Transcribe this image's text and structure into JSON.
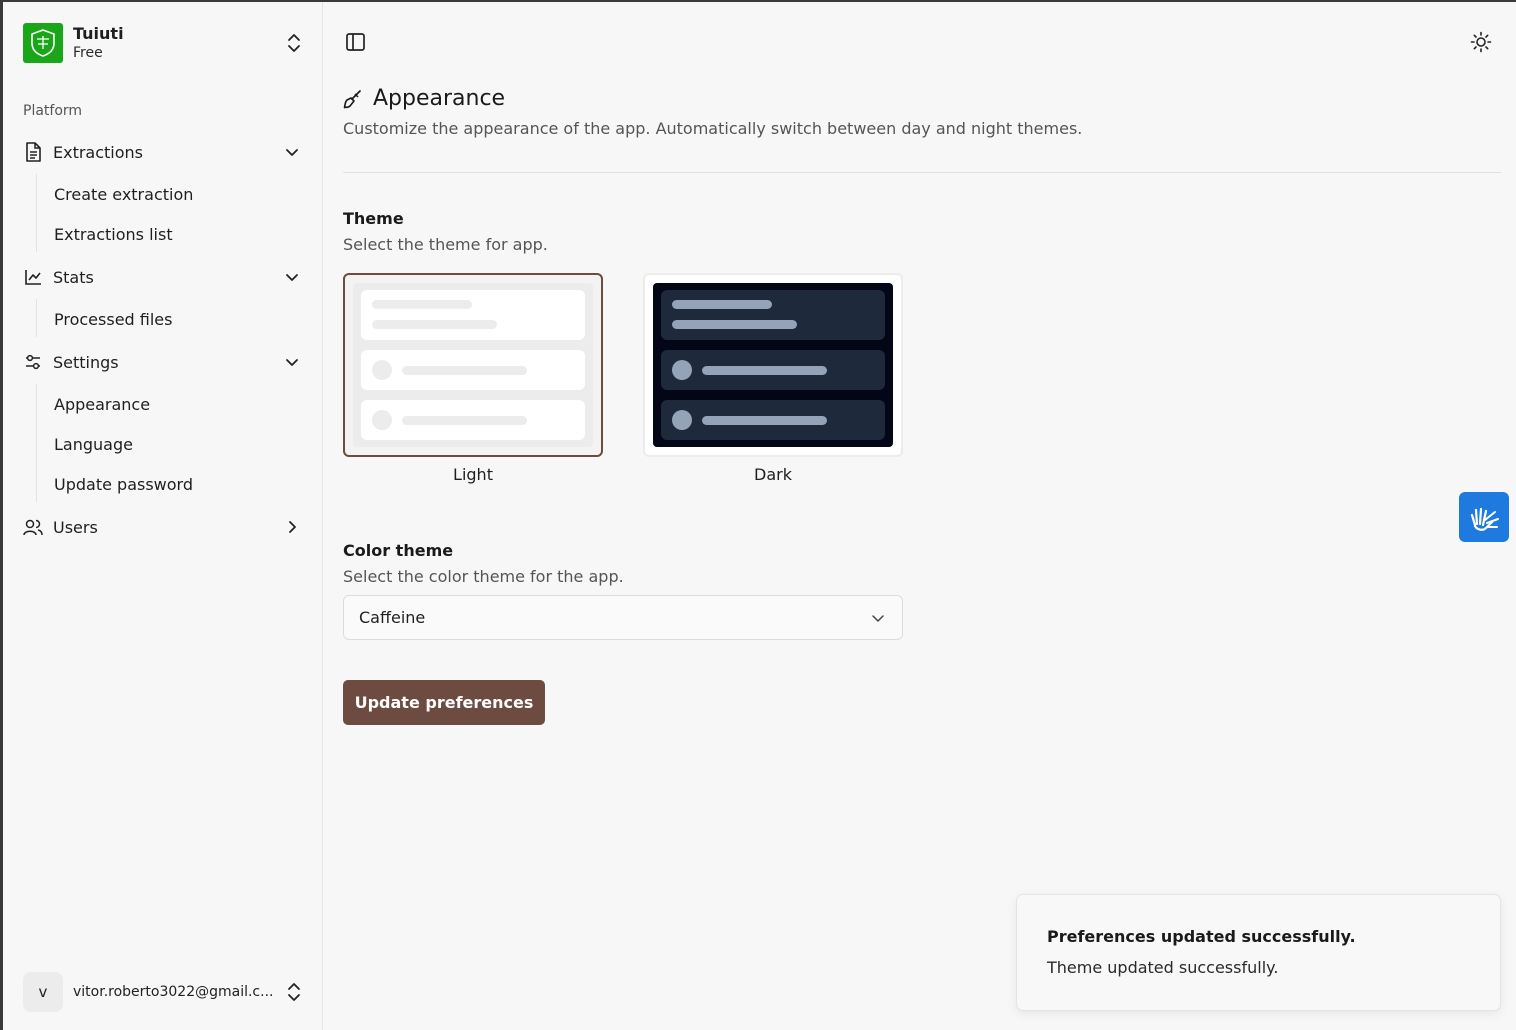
{
  "team": {
    "name": "Tuiuti",
    "plan": "Free"
  },
  "sidebar": {
    "group_label": "Platform",
    "extractions": {
      "label": "Extractions",
      "items": [
        "Create extraction",
        "Extractions list"
      ]
    },
    "stats": {
      "label": "Stats",
      "items": [
        "Processed files"
      ]
    },
    "settings": {
      "label": "Settings",
      "items": [
        "Appearance",
        "Language",
        "Update password"
      ]
    },
    "users": {
      "label": "Users"
    }
  },
  "user": {
    "initial": "v",
    "email": "vitor.roberto3022@gmail.c..."
  },
  "page": {
    "title": "Appearance",
    "subtitle": "Customize the appearance of the app. Automatically switch between day and night themes."
  },
  "theme_section": {
    "label": "Theme",
    "description": "Select the theme for app.",
    "options": {
      "light": "Light",
      "dark": "Dark"
    },
    "selected": "Light"
  },
  "color_section": {
    "label": "Color theme",
    "description": "Select the color theme for the app.",
    "selected": "Caffeine"
  },
  "submit_label": "Update preferences",
  "toast": {
    "title": "Preferences updated successfully.",
    "description": "Theme updated successfully."
  },
  "colors": {
    "primary": "#6d4b40",
    "logo_bg": "#19a619",
    "a11y_button": "#1f7ae0",
    "dark_theme_bg": "#020617",
    "dark_theme_block": "#1e293b"
  }
}
